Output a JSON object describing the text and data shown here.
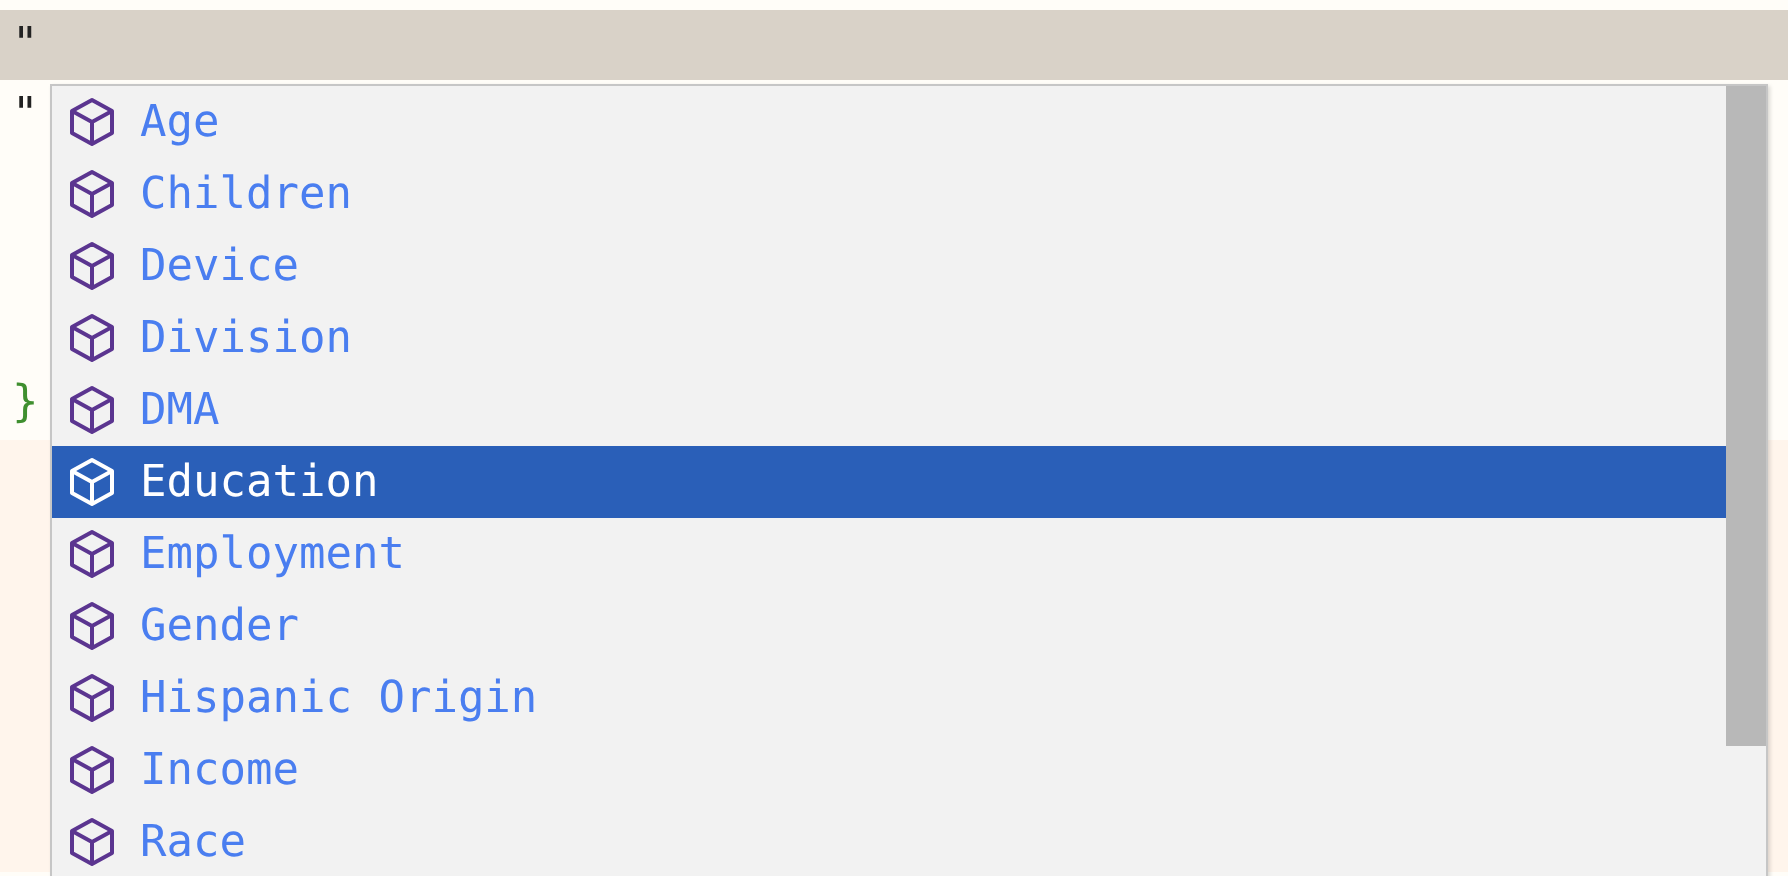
{
  "editor": {
    "lines": [
      {
        "text": "\"",
        "marked": true,
        "current": false,
        "kind": "string"
      },
      {
        "text": "\"",
        "marked": false,
        "current": false,
        "kind": "string"
      },
      {
        "marked": false,
        "current": false
      },
      {
        "marked": false,
        "current": false
      },
      {
        "marked": false,
        "current": false
      },
      {
        "text": "}",
        "marked": false,
        "current": false,
        "kind": "brace"
      },
      {
        "marked": false,
        "current": true
      },
      {
        "marked": false,
        "current": true
      },
      {
        "marked": false,
        "current": true
      },
      {
        "marked": false,
        "current": true
      },
      {
        "marked": false,
        "current": true
      },
      {
        "marked": false,
        "current": true
      }
    ]
  },
  "completion": {
    "items": [
      {
        "label": "Age",
        "selected": false
      },
      {
        "label": "Children",
        "selected": false
      },
      {
        "label": "Device",
        "selected": false
      },
      {
        "label": "Division",
        "selected": false
      },
      {
        "label": "DMA",
        "selected": false
      },
      {
        "label": "Education",
        "selected": true
      },
      {
        "label": "Employment",
        "selected": false
      },
      {
        "label": "Gender",
        "selected": false
      },
      {
        "label": "Hispanic Origin",
        "selected": false
      },
      {
        "label": "Income",
        "selected": false
      },
      {
        "label": "Race",
        "selected": false
      }
    ]
  }
}
